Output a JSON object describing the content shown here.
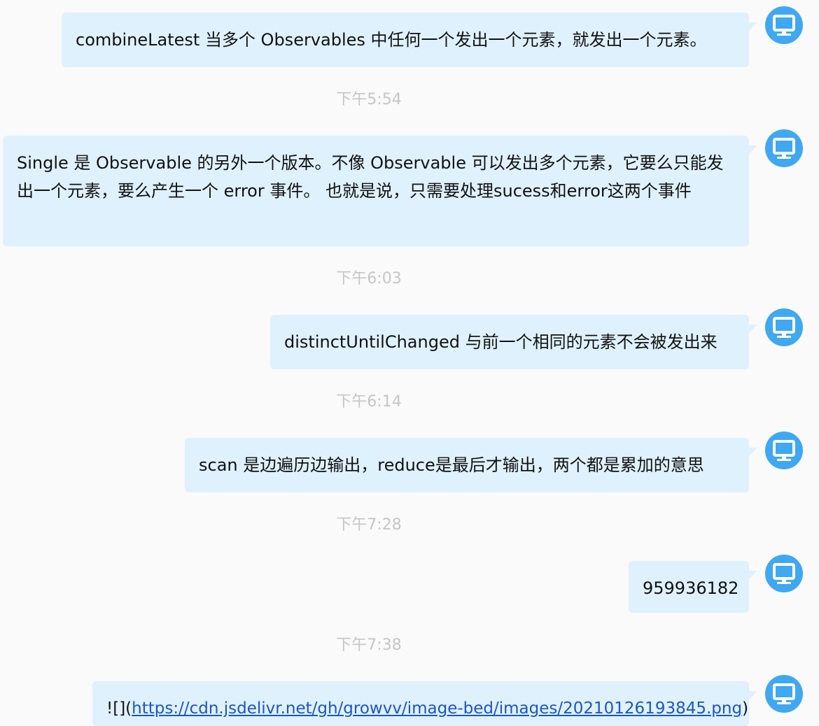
{
  "messages": [
    {
      "text": "combineLatest  当多个 Observables 中任何一个发出一个元素，就发出一个元素。"
    },
    {
      "text": "Single 是 Observable 的另外一个版本。不像 Observable 可以发出多个元素，它要么只能发出一个元素，要么产生一个 error 事件。 也就是说，只需要处理sucess和error这两个事件"
    },
    {
      "text": "distinctUntilChanged  与前一个相同的元素不会被发出来"
    },
    {
      "text": "scan 是边遍历边输出，reduce是最后才输出，两个都是累加的意思"
    },
    {
      "text": "959936182"
    },
    {
      "prefix": "![](",
      "link": "https://cdn.jsdelivr.net/gh/growvv/image-bed/images/20210126193845.png",
      "suffix": ")"
    }
  ],
  "timestamps": [
    "下午5:54",
    "下午6:03",
    "下午6:14",
    "下午7:28",
    "下午7:38"
  ],
  "colors": {
    "bubble": "#dff1fc",
    "avatar": "#3fa8f0",
    "timestamp": "#c6c6c6",
    "link": "#1a55c9"
  },
  "icons": {
    "avatar": "monitor-icon"
  }
}
